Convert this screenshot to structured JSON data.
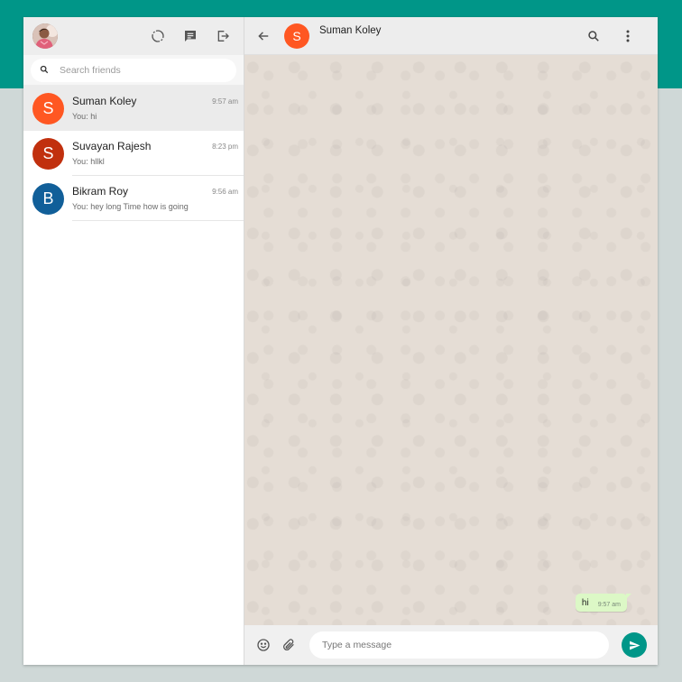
{
  "colors": {
    "brand_teal": "#009688",
    "avatar_suman": "#ff5722",
    "avatar_suvayan": "#c1300e",
    "avatar_bikram": "#115f99",
    "outgoing_bubble": "#dcf8c6"
  },
  "sidebar": {
    "header_icons": [
      "status-icon",
      "new-chat-icon",
      "logout-icon"
    ],
    "search": {
      "placeholder": "Search friends",
      "value": ""
    },
    "chats": [
      {
        "initial": "S",
        "name": "Suman Koley",
        "last_message": "You: hi",
        "time": "9:57 am",
        "active": true
      },
      {
        "initial": "S",
        "name": "Suvayan Rajesh",
        "last_message": "You: hllkl",
        "time": "8:23 pm",
        "active": false
      },
      {
        "initial": "B",
        "name": "Bikram Roy",
        "last_message": "You: hey long Time how is going",
        "time": "9:56 am",
        "active": false
      }
    ]
  },
  "conversation": {
    "contact_initial": "S",
    "contact_name": "Suman Koley",
    "header_icons": [
      "back-arrow-icon",
      "search-icon",
      "more-vert-icon"
    ],
    "messages": [
      {
        "text": "hi",
        "time": "9:57 am",
        "outgoing": true
      }
    ]
  },
  "composer": {
    "placeholder": "Type a message",
    "value": "",
    "icons": [
      "emoji-icon",
      "attach-icon",
      "send-icon"
    ]
  }
}
